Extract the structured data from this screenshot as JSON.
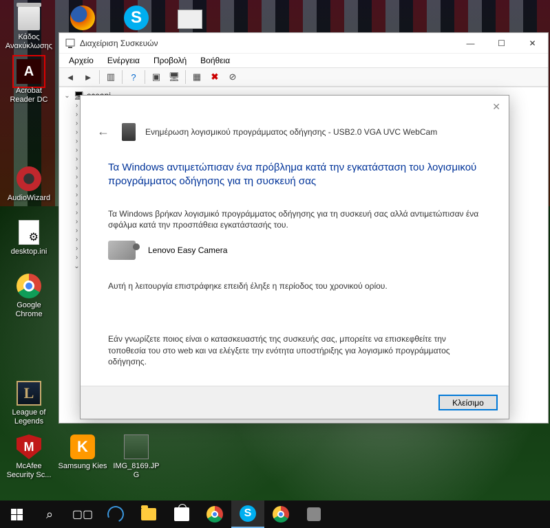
{
  "desktop": {
    "icons": [
      {
        "label": "Κάδος Ανακύκλωσης"
      },
      {
        "label": ""
      },
      {
        "label": ""
      },
      {
        "label": ""
      },
      {
        "label": "Acrobat Reader DC"
      },
      {
        "label": "AudioWizard"
      },
      {
        "label": "desktop.ini"
      },
      {
        "label": "Google Chrome"
      },
      {
        "label": "League of Legends"
      },
      {
        "label": "McAfee Security Sc..."
      },
      {
        "label": "Samsung Kies"
      },
      {
        "label": "IMG_8169.JPG"
      }
    ]
  },
  "devmgr": {
    "title": "Διαχείριση Συσκευών",
    "menu": [
      "Αρχείο",
      "Ενέργεια",
      "Προβολή",
      "Βοήθεια"
    ],
    "root": "sceapi"
  },
  "dialog": {
    "title": "Ενημέρωση λογισμικού προγράμματος οδήγησης - USB2.0 VGA UVC WebCam",
    "heading": "Τα Windows αντιμετώπισαν ένα πρόβλημα κατά την εγκατάσταση του λογισμικού προγράμματος οδήγησης για τη συσκευή σας",
    "body1": "Τα Windows βρήκαν λογισμικό προγράμματος οδήγησης για τη συσκευή σας αλλά αντιμετώπισαν ένα σφάλμα κατά την προσπάθεια εγκατάστασής του.",
    "device": "Lenovo Easy Camera",
    "body2": "Αυτή η λειτουργία επιστράφηκε επειδή έληξε η περίοδος του χρονικού ορίου.",
    "body3": "Εάν γνωρίζετε ποιος είναι ο κατασκευαστής της συσκευής σας, μπορείτε να επισκεφθείτε την τοποθεσία του στο web και να ελέγξετε την ενότητα υποστήριξης για λογισμικό προγράμματος οδήγησης.",
    "close": "Κλείσιμο"
  }
}
